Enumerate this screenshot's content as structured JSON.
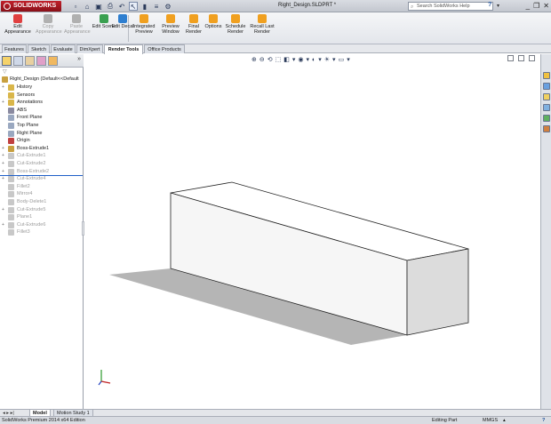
{
  "app": {
    "brand": "SOLIDWORKS",
    "document_title": "Right_Design.SLDPRT *"
  },
  "search": {
    "placeholder": "Search SolidWorks Help",
    "help": "?",
    "dropdown": "▾"
  },
  "quick_access": [
    {
      "icon": "new-document-icon",
      "glyph": "▫"
    },
    {
      "icon": "open-folder-icon",
      "glyph": "⌂"
    },
    {
      "icon": "save-icon",
      "glyph": "▣"
    },
    {
      "icon": "print-icon",
      "glyph": "⎙"
    },
    {
      "icon": "undo-icon",
      "glyph": "↶"
    },
    {
      "icon": "select-arrow-icon",
      "glyph": "↖"
    },
    {
      "icon": "rebuild-icon",
      "glyph": "▮"
    },
    {
      "icon": "file-properties-icon",
      "glyph": "≡"
    },
    {
      "icon": "options-gear-icon",
      "glyph": "⚙"
    }
  ],
  "window_controls": {
    "minimize": "_",
    "restore": "❐",
    "close": "✕"
  },
  "ribbon": {
    "buttons": [
      {
        "name": "edit-appearance-button",
        "label": "Edit Appearance",
        "enabled": true,
        "color": "#e04040"
      },
      {
        "name": "copy-appearance-button",
        "label": "Copy Appearance",
        "enabled": false,
        "color": "#b0b0b0"
      },
      {
        "name": "paste-appearance-button",
        "label": "Paste Appearance",
        "enabled": false,
        "color": "#b0b0b0"
      },
      {
        "name": "edit-scene-button",
        "label": "Edit Scene",
        "enabled": true,
        "color": "#3aa050"
      },
      {
        "name": "edit-decal-button",
        "label": "Edit Decal",
        "enabled": true,
        "color": "#2f7fd0"
      },
      {
        "name": "integrated-preview-button",
        "label": "Integrated Preview",
        "enabled": true,
        "color": "#f0a020"
      },
      {
        "name": "preview-window-button",
        "label": "Preview Window",
        "enabled": true,
        "color": "#f0a020"
      },
      {
        "name": "final-render-button",
        "label": "Final Render",
        "enabled": true,
        "color": "#f0a020"
      },
      {
        "name": "options-button",
        "label": "Options",
        "enabled": true,
        "color": "#f0a020"
      },
      {
        "name": "schedule-render-button",
        "label": "Schedule Render",
        "enabled": true,
        "color": "#f0a020"
      },
      {
        "name": "recall-last-render-button",
        "label": "Recall Last Render",
        "enabled": true,
        "color": "#f0a020"
      }
    ]
  },
  "command_tabs": [
    "Features",
    "Sketch",
    "Evaluate",
    "DimXpert",
    "Render Tools",
    "Office Products"
  ],
  "active_command_tab": "Render Tools",
  "feature_tree": {
    "filter_glyph": "▽",
    "more_glyph": "»",
    "root": "Right_Design  (Default<<Default",
    "items": [
      {
        "label": "History",
        "icon": "history-folder-icon",
        "color": "#d9b64a",
        "suppressed": false,
        "expander": "+"
      },
      {
        "label": "Sensors",
        "icon": "sensors-folder-icon",
        "color": "#d9b64a",
        "suppressed": false,
        "expander": ""
      },
      {
        "label": "Annotations",
        "icon": "annotations-folder-icon",
        "color": "#d9b64a",
        "suppressed": false,
        "expander": "+"
      },
      {
        "label": "ABS",
        "icon": "material-icon",
        "color": "#8a8aa0",
        "suppressed": false,
        "expander": ""
      },
      {
        "label": "Front Plane",
        "icon": "plane-icon",
        "color": "#9aa8c0",
        "suppressed": false,
        "expander": ""
      },
      {
        "label": "Top Plane",
        "icon": "plane-icon",
        "color": "#9aa8c0",
        "suppressed": false,
        "expander": ""
      },
      {
        "label": "Right Plane",
        "icon": "plane-icon",
        "color": "#9aa8c0",
        "suppressed": false,
        "expander": ""
      },
      {
        "label": "Origin",
        "icon": "origin-icon",
        "color": "#c04040",
        "suppressed": false,
        "expander": ""
      },
      {
        "label": "Boss-Extrude1",
        "icon": "extrude-icon",
        "color": "#c8a040",
        "suppressed": false,
        "expander": "+"
      },
      {
        "label": "Cut-Extrude1",
        "icon": "cut-extrude-icon",
        "color": "#c8c8c8",
        "suppressed": true,
        "expander": "+"
      },
      {
        "label": "Cut-Extrude2",
        "icon": "cut-extrude-icon",
        "color": "#c8c8c8",
        "suppressed": true,
        "expander": "+"
      },
      {
        "label": "Boss-Extrude2",
        "icon": "extrude-icon",
        "color": "#c8c8c8",
        "suppressed": true,
        "expander": "+"
      },
      {
        "label": "Cut-Extrude4",
        "icon": "cut-extrude-icon",
        "color": "#c8c8c8",
        "suppressed": true,
        "expander": "+"
      },
      {
        "label": "Fillet2",
        "icon": "fillet-icon",
        "color": "#c8c8c8",
        "suppressed": true,
        "expander": ""
      },
      {
        "label": "Mirror4",
        "icon": "mirror-icon",
        "color": "#c8c8c8",
        "suppressed": true,
        "expander": ""
      },
      {
        "label": "Body-Delete1",
        "icon": "body-delete-icon",
        "color": "#c8c8c8",
        "suppressed": true,
        "expander": ""
      },
      {
        "label": "Cut-Extrude5",
        "icon": "cut-extrude-icon",
        "color": "#c8c8c8",
        "suppressed": true,
        "expander": "+"
      },
      {
        "label": "Plane1",
        "icon": "plane-icon",
        "color": "#c8c8c8",
        "suppressed": true,
        "expander": ""
      },
      {
        "label": "Cut-Extrude6",
        "icon": "cut-extrude-icon",
        "color": "#c8c8c8",
        "suppressed": true,
        "expander": "+"
      },
      {
        "label": "Fillet3",
        "icon": "fillet-icon",
        "color": "#c8c8c8",
        "suppressed": true,
        "expander": ""
      }
    ]
  },
  "heads_up_toolbar": [
    "⊕",
    "⊖",
    "⟲",
    "⬚",
    "◧",
    "▾",
    "◉",
    "▾",
    "◐",
    "▾",
    "☀",
    "▾",
    "▭",
    "▾"
  ],
  "bottom_tabs": {
    "nav": "◂ ▸ ▸|",
    "items": [
      "Model",
      "Motion Study 1"
    ],
    "active": "Model"
  },
  "status": {
    "edition": "SolidWorks Premium 2014 x64 Edition",
    "mode": "Editing Part",
    "units": "MMGS",
    "units_drop": "▴",
    "help_glyph": "?"
  },
  "colors": {
    "accent_red": "#b01820",
    "selection_blue": "#1e5fc8",
    "model_face_front": "#f6f6f6",
    "model_face_top": "#ffffff",
    "model_face_end": "#dcdcdc",
    "shadow": "#a8a8a8"
  }
}
